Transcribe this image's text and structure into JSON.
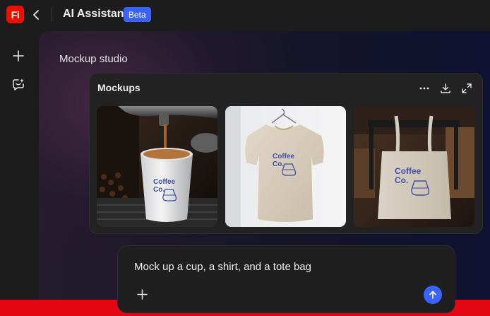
{
  "header": {
    "logo_text": "Fi",
    "back_icon": "chevron-left-icon",
    "title": "AI Assistant",
    "badge": "Beta"
  },
  "rail": {
    "items": [
      {
        "icon": "plus-icon"
      },
      {
        "icon": "chat-sparkle-icon"
      }
    ]
  },
  "main": {
    "title": "Mockup studio"
  },
  "card": {
    "title": "Mockups",
    "actions": [
      {
        "icon": "more-icon"
      },
      {
        "icon": "download-icon"
      },
      {
        "icon": "expand-icon"
      }
    ],
    "mockups": [
      {
        "subject": "cup",
        "brand_line1": "Coffee",
        "brand_line2": "Co."
      },
      {
        "subject": "shirt",
        "brand_line1": "Coffee",
        "brand_line2": "Co."
      },
      {
        "subject": "tote-bag",
        "brand_line1": "Coffee",
        "brand_line2": "Co."
      }
    ]
  },
  "prompt": {
    "text": "Mock up a cup, a shirt, and a tote bag",
    "add_icon": "plus-icon",
    "send_icon": "arrow-up-icon"
  },
  "colors": {
    "accent": "#3b63fb",
    "logo_red": "#eb1000",
    "bottom_strip": "#e30613",
    "brand_print": "#3f4fa8"
  }
}
